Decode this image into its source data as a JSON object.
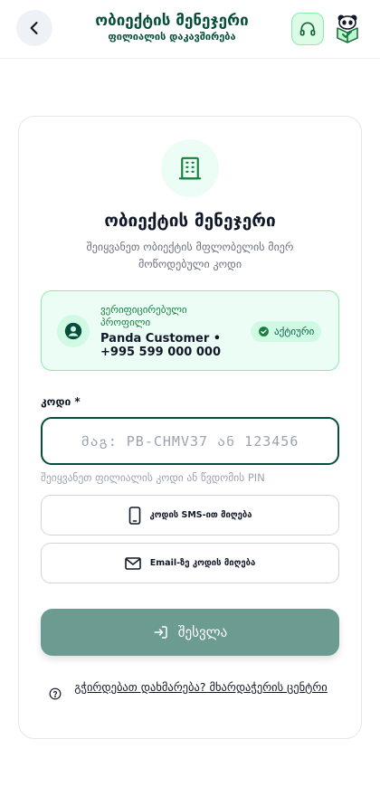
{
  "header": {
    "title": "ობიექტის მენეჯერი",
    "subtitle": "ფილიალის დაკავშირება"
  },
  "icons": {
    "back": "chevron-left-icon",
    "support": "headset-icon",
    "logo": "panda-logo-icon",
    "hero": "building-icon",
    "avatar": "user-icon",
    "badge": "check-circle-icon",
    "sms": "phone-icon",
    "email": "mail-icon",
    "submit": "login-icon",
    "help": "help-circle-icon"
  },
  "card": {
    "title": "ობიექტის მენეჯერი",
    "subtitle": "შეიყვანეთ ობიექტის მფლობელის მიერ მოწოდებული კოდი"
  },
  "profile": {
    "label": "ვერიფიცირებული პროფილი",
    "name": "Panda Customer • +995 599 000 000",
    "status": "აქტიური"
  },
  "code_field": {
    "label": "კოდი *",
    "value": "",
    "placeholder": "მაგ: PB-CHMV37 ან 123456",
    "hint": "შეიყვანეთ ფილიალის კოდი ან წვდომის PIN"
  },
  "actions": {
    "sms_label": "კოდის SMS-ით მიღება",
    "email_label": "Email-ზე კოდის მიღება",
    "submit_label": "შესვლა"
  },
  "help": {
    "text": "გჭირდებათ დახმარება? მხარდაჭერის ცენტრი"
  },
  "colors": {
    "brand_dark": "#064e3b",
    "accent_green": "#16a34a",
    "submit_bg": "#6b9b91",
    "profile_bg": "#ecfdf5"
  }
}
